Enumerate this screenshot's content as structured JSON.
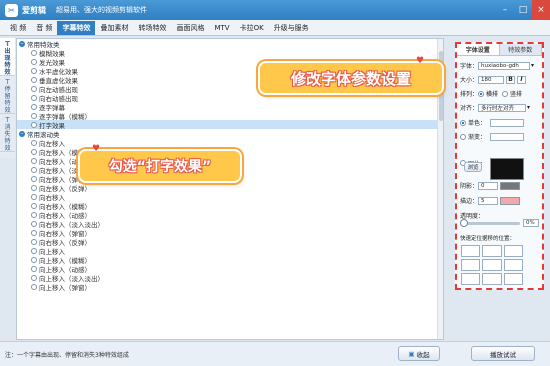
{
  "app": {
    "name": "爱剪辑",
    "slogan": "超易用、强大的视频剪辑软件"
  },
  "menu": {
    "items": [
      "视 频",
      "音 频",
      "字幕特效",
      "叠加素材",
      "转场特效",
      "画面风格",
      "MTV",
      "卡拉OK",
      "升级与服务"
    ],
    "active": "字幕特效"
  },
  "sidetabs": [
    {
      "label": "出现特效",
      "icon": "T"
    },
    {
      "label": "停留特效",
      "icon": "T"
    },
    {
      "label": "消失特效",
      "icon": "T"
    }
  ],
  "groups": [
    {
      "title": "常用特效类",
      "items": [
        "模糊效果",
        "发光效果",
        "水平虚化效果",
        "垂直虚化效果",
        "向左动感出现",
        "向右动感出现",
        "逐字弹幕",
        "逐字弹幕（模糊）",
        "打字效果"
      ],
      "selected": "打字效果"
    },
    {
      "title": "常用滚动类",
      "items": [
        "向左移入",
        "向左移入（模糊）",
        "向左移入（动感）",
        "向左移入（淡入淡出）",
        "向左移入（弹窗）",
        "向左移入（反弹）",
        "向右移入",
        "向右移入（模糊）",
        "向右移入（动感）",
        "向右移入（淡入淡出）",
        "向右移入（弹窗）",
        "向右移入（反弹）",
        "向上移入",
        "向上移入（模糊）",
        "向上移入（动感）",
        "向上移入（淡入淡出）",
        "向上移入（弹窗）"
      ]
    }
  ],
  "callouts": {
    "font_settings": "修改字体参数设置",
    "typing_effect": "勾选“打字效果”"
  },
  "bottom": {
    "note": "注：一个字幕由出现、停留和消失3种特效组成",
    "collapse_label": "收起",
    "preview_label": "播放试试"
  },
  "props": {
    "tabs": [
      "字体设置",
      "特效参数"
    ],
    "font_label": "字体：",
    "font_value": "huxiaobo-gdh",
    "size_label": "大小：",
    "size_value": "180",
    "bold": "B",
    "italic": "I",
    "arrange_label": "排列：",
    "arrange_options": [
      "横排",
      "竖排"
    ],
    "arrange_selected": "横排",
    "align_label": "对齐：",
    "align_value": "多行时左对齐",
    "fill_options": [
      "单色：",
      "渐变：",
      "图片："
    ],
    "fill_selected": "单色：",
    "browse": "浏览",
    "shadow_label": "阴影：",
    "shadow_value": "0",
    "stroke_label": "描边：",
    "stroke_value": "5",
    "opacity_label": "透明度：",
    "opacity_value": "0%",
    "opacity_fraction": 0,
    "position_label": "快速定位据移的位置："
  },
  "colors": {
    "accent": "#2f7fc2",
    "callout": "#ffc84a",
    "stroke_swatch": "#f2aaa8",
    "shadow_swatch": "#777777",
    "panel_border": "#e53935"
  }
}
